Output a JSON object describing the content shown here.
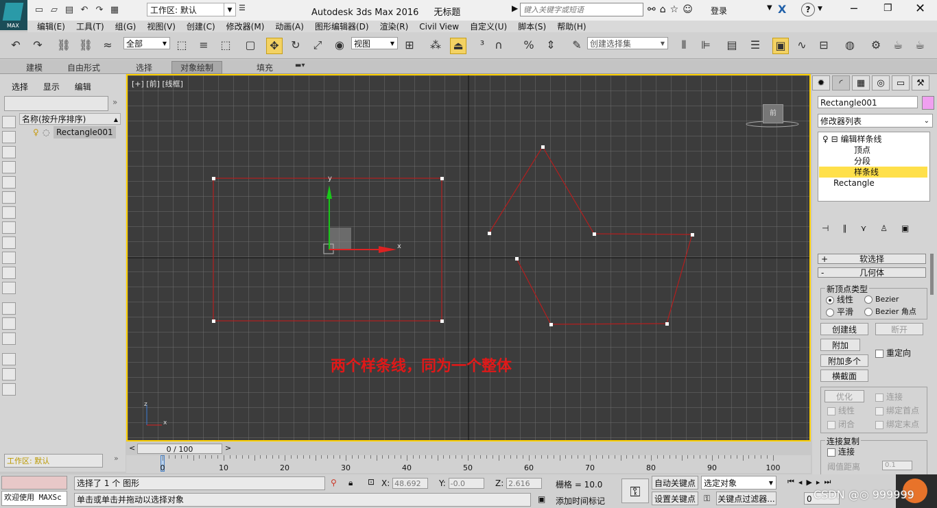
{
  "app": {
    "logo_text": "MAX",
    "title": "Autodesk 3ds Max 2016",
    "doc": "无标题",
    "workspace": "工作区: 默认",
    "search_placeholder": "键入关键字或短语",
    "login": "登录"
  },
  "menu": [
    "编辑(E)",
    "工具(T)",
    "组(G)",
    "视图(V)",
    "创建(C)",
    "修改器(M)",
    "动画(A)",
    "图形编辑器(D)",
    "渲染(R)",
    "Civil View",
    "自定义(U)",
    "脚本(S)",
    "帮助(H)"
  ],
  "toolbar": {
    "filter": "全部",
    "ref_coord": "视图",
    "named_sel_placeholder": "创建选择集"
  },
  "ribbon_tabs": [
    "建模",
    "自由形式",
    "选择",
    "对象绘制",
    "填充"
  ],
  "explorer": {
    "menu": [
      "选择",
      "显示",
      "编辑"
    ],
    "header": "名称(按升序排序)",
    "item": "Rectangle001",
    "layer": "工作区: 默认"
  },
  "viewport": {
    "label": "[+] [前] [线框]",
    "note": "两个样条线，同为一个整体",
    "viewcube": "前"
  },
  "command_panel": {
    "object_name": "Rectangle001",
    "object_color": "#f0a0f0",
    "modifier_list": "修改器列表",
    "stack": [
      "编辑样条线",
      "顶点",
      "分段",
      "样条线",
      "Rectangle"
    ],
    "rollout_soft": "软选择",
    "rollout_geom": "几何体",
    "new_vertex_type": "新顶点类型",
    "radio_linear": "线性",
    "radio_bezier": "Bezier",
    "radio_smooth": "平滑",
    "radio_bezier_corner": "Bezier 角点",
    "btn_create_line": "创建线",
    "btn_break": "断开",
    "btn_attach": "附加",
    "chk_reorient": "重定向",
    "btn_attach_multi": "附加多个",
    "btn_cross_section": "横截面",
    "btn_refine": "优化",
    "chk_connect": "连接",
    "chk_linear": "线性",
    "chk_bind_first": "绑定首点",
    "chk_closed": "闭合",
    "chk_bind_last": "绑定末点",
    "connect_copy": "连接复制",
    "chk_connect2": "连接",
    "threshold_label": "阈值距离",
    "threshold_value": "0.1"
  },
  "timeline": {
    "position": "0 / 100",
    "ticks": [
      "0",
      "10",
      "20",
      "30",
      "40",
      "50",
      "60",
      "70",
      "80",
      "90",
      "100"
    ]
  },
  "status": {
    "maxscript": "欢迎使用 MAXSc",
    "selected": "选择了 1 个 图形",
    "prompt": "单击或单击并拖动以选择对象",
    "x": "48.692",
    "y": "-0.0",
    "z": "2.616",
    "grid": "栅格 = 10.0",
    "add_time_tag": "添加时间标记",
    "auto_key": "自动关键点",
    "set_key": "设置关键点",
    "selected_object": "选定对象",
    "key_filters": "关键点过滤器...",
    "frame": "0",
    "watermark": "CSDN @◎ 999999"
  },
  "colors": {
    "viewport_bg": "#3c3c3c",
    "grid": "#6e6e6e",
    "selection": "#ffd200",
    "spline": "#b41e1e",
    "note": "#e01818"
  }
}
